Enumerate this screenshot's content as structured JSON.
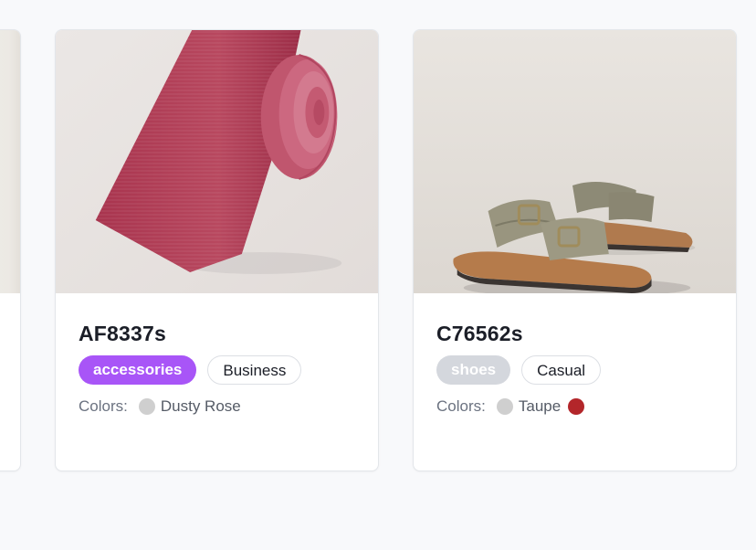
{
  "products": [
    {
      "sku": "AF8337s",
      "category": "accessories",
      "category_color": "#a855f7",
      "style": "Business",
      "colors_label": "Colors:",
      "color_name": "Dusty Rose",
      "swatches": [
        "#cfcfcf"
      ],
      "image": "necktie-image"
    },
    {
      "sku": "C76562s",
      "category": "shoes",
      "category_color": "#d4d7dd",
      "style": "Casual",
      "colors_label": "Colors:",
      "color_name": "Taupe",
      "swatches": [
        "#cfcfcf",
        "#b3262a"
      ],
      "image": "sandals-image"
    }
  ]
}
